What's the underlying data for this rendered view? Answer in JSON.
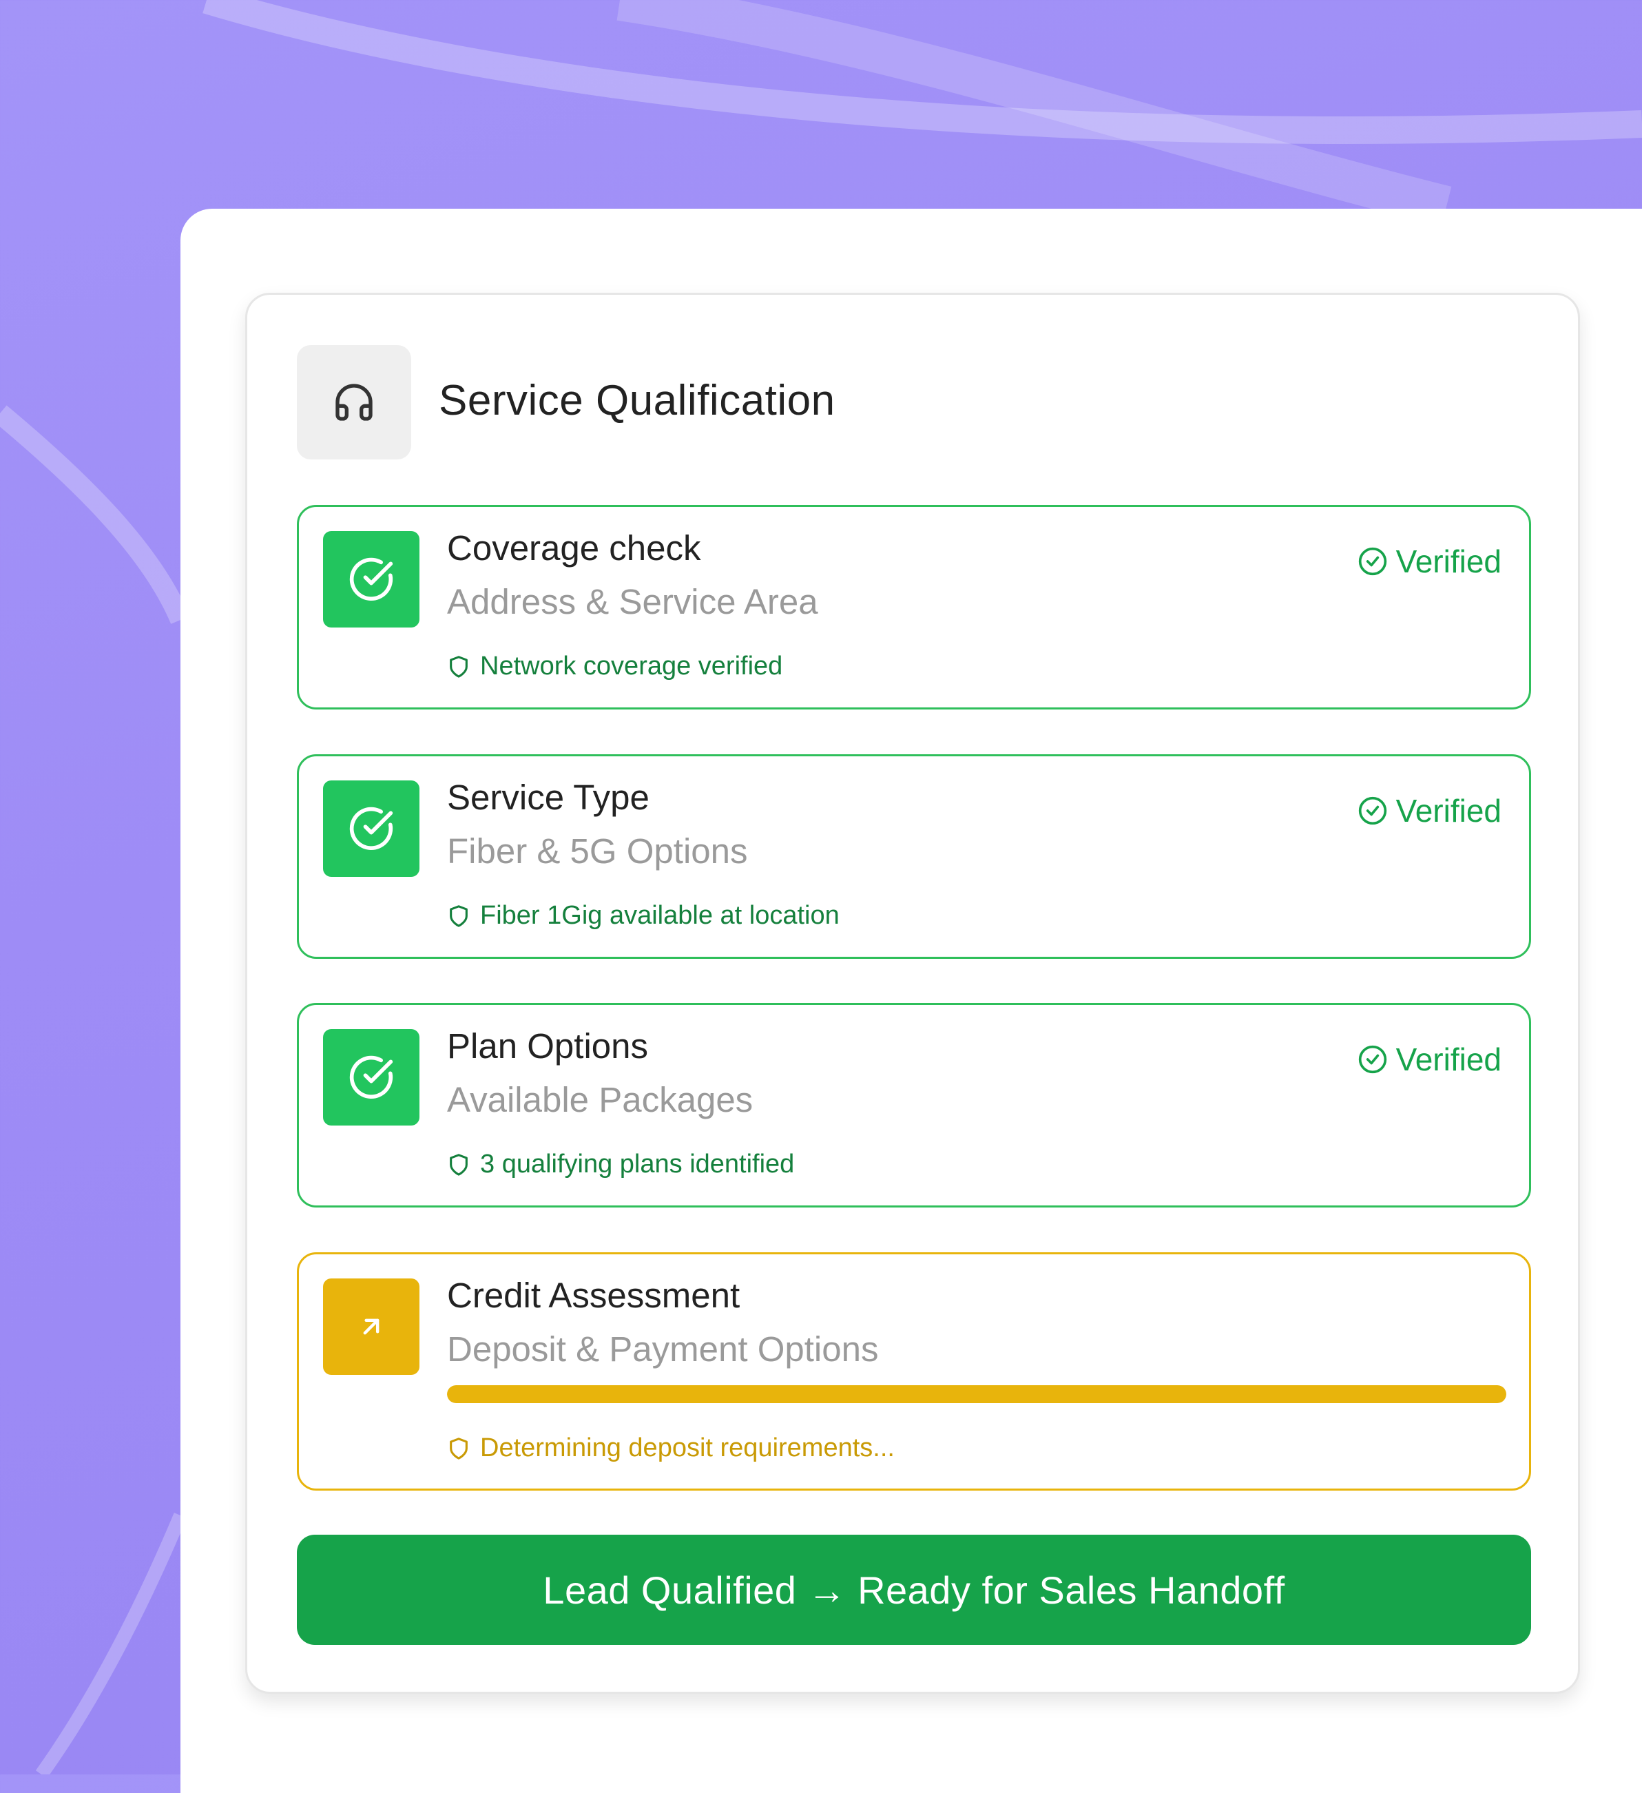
{
  "header": {
    "icon": "headset-icon",
    "title": "Service Qualification"
  },
  "steps": [
    {
      "title": "Coverage check",
      "subtitle": "Address & Service Area",
      "status": "Verified",
      "note": "Network coverage verified",
      "state": "verified"
    },
    {
      "title": "Service Type",
      "subtitle": "Fiber & 5G Options",
      "status": "Verified",
      "note": "Fiber 1Gig available at location",
      "state": "verified"
    },
    {
      "title": "Plan Options",
      "subtitle": "Available Packages",
      "status": "Verified",
      "note": "3 qualifying plans identified",
      "state": "verified"
    },
    {
      "title": "Credit Assessment",
      "subtitle": "Deposit & Payment Options",
      "note": "Determining deposit requirements...",
      "state": "in-progress",
      "progress": 1.0
    }
  ],
  "cta": {
    "label": "Lead Qualified → Ready for Sales Handoff"
  },
  "colors": {
    "verified": "#22c55e",
    "pending": "#e8b40c",
    "cta": "#16a34a"
  }
}
